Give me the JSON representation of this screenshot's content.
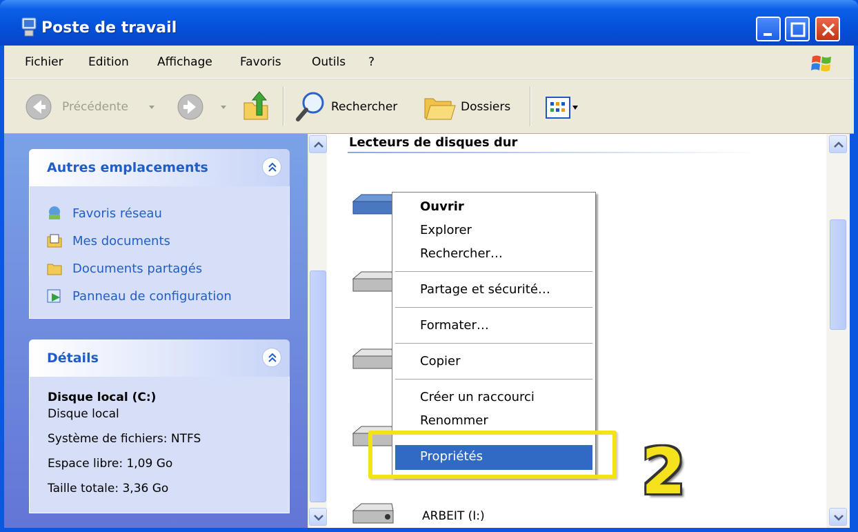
{
  "window": {
    "title": "Poste de travail",
    "colors": {
      "titlebar": "#0550d8",
      "taskpane": "#7ba2e7",
      "selection": "#316ac5",
      "highlight": "#f2e21a"
    }
  },
  "menubar": {
    "items": [
      "Fichier",
      "Edition",
      "Affichage",
      "Favoris",
      "Outils",
      "?"
    ]
  },
  "toolbar": {
    "back_label": "Précédente",
    "search_label": "Rechercher",
    "folders_label": "Dossiers"
  },
  "taskpane": {
    "other_places": {
      "title": "Autres emplacements",
      "links": [
        "Favoris réseau",
        "Mes documents",
        "Documents partagés",
        "Panneau de configuration"
      ]
    },
    "details": {
      "title": "Détails",
      "name": "Disque local (C:)",
      "type": "Disque local",
      "filesystem": "Système de fichiers: NTFS",
      "free_space": "Espace libre: 1,09 Go",
      "total_size": "Taille totale: 3,36 Go"
    }
  },
  "content": {
    "group_title": "Lecteurs de disques dur",
    "last_drive_label": "ARBEIT (I:)"
  },
  "context_menu": {
    "items": [
      "Ouvrir",
      "Explorer",
      "Rechercher…",
      "Partage et sécurité…",
      "Formater…",
      "Copier",
      "Créer un raccourci",
      "Renommer",
      "Propriétés"
    ],
    "selected": "Propriétés"
  },
  "annotation": {
    "step": "2"
  }
}
